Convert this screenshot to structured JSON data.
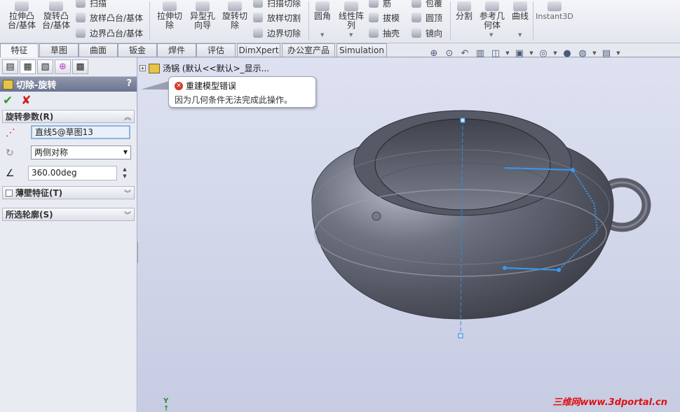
{
  "ribbon": {
    "extrude_boss": "拉伸凸\n台/基体",
    "revolve_boss": "旋转凸\n台/基体",
    "sweep": "扫描",
    "loft_boss": "放样凸台/基体",
    "boundary_boss": "边界凸台/基体",
    "extrude_cut": "拉伸切\n除",
    "hole_wizard": "异型孔\n向导",
    "revolve_cut": "旋转切\n除",
    "sweep_cut": "扫描切除",
    "loft_cut": "放样切割",
    "boundary_cut": "边界切除",
    "fillet": "圆角",
    "linear_pattern": "线性阵\n列",
    "rib": "筋",
    "draft": "拔模",
    "shell": "抽壳",
    "wrap": "包覆",
    "dome": "圆顶",
    "mirror": "镜向",
    "split": "分割",
    "ref_geometry": "参考几\n何体",
    "curves": "曲线",
    "instant3d": "Instant3D"
  },
  "tabs": [
    "特征",
    "草图",
    "曲面",
    "钣金",
    "焊件",
    "评估",
    "DimXpert",
    "办公室产品",
    "Simulation"
  ],
  "active_tab": "特征",
  "view_icons": [
    "zoom-to-fit-icon",
    "zoom-area-icon",
    "previous-view-icon",
    "section-view-icon",
    "view-orientation-icon",
    "display-style-icon",
    "hide-show-icon",
    "appearance-icon",
    "scene-icon",
    "view-settings-icon"
  ],
  "property_manager": {
    "title": "切除-旋转",
    "help": "?",
    "ok_symbol": "✔",
    "cancel_symbol": "✘",
    "section_rotation": "旋转参数(R)",
    "axis_value": "直线5@草图13",
    "direction_value": "两侧对称",
    "angle_value": "360.00deg",
    "section_thin": "薄壁特征(T)",
    "section_contours": "所选轮廓(S)"
  },
  "tree": {
    "expand": "+",
    "part_label": "汤锅 (默认<<默认>_显示..."
  },
  "tooltip": {
    "title": "重建模型错误",
    "message": "因为几何条件无法完成此操作。"
  },
  "watermark": "三维网www.3dportal.cn",
  "colors": {
    "viewport_bg": "#d4d8eb",
    "model_body": "#6d7180",
    "sketch": "#2f8fe0",
    "title_bar": "#7a829c"
  }
}
